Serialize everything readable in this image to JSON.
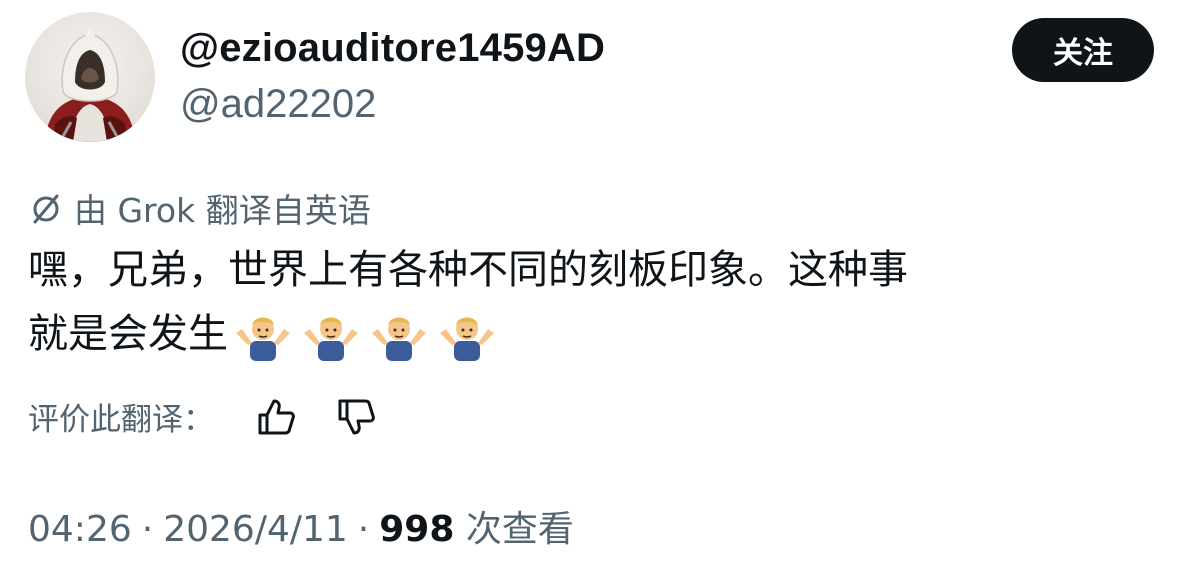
{
  "author": {
    "display_name": "@ezioauditore1459AD",
    "handle": "@ad22202",
    "avatar_icon": "hooded-assassin-avatar"
  },
  "follow_button": {
    "label": "关注"
  },
  "translation_note": {
    "icon": "translate-slash-icon",
    "text": "由 Grok 翻译自英语"
  },
  "tweet": {
    "line1": "嘿，兄弟，世界上有各种不同的刻板印象。这种事",
    "line2": "就是会发生",
    "emojis": [
      "man-shrugging-emoji",
      "man-shrugging-emoji",
      "man-shrugging-emoji",
      "man-shrugging-emoji"
    ]
  },
  "rate_translation": {
    "label": "评价此翻译：",
    "thumbs_up_icon": "thumbs-up-icon",
    "thumbs_down_icon": "thumbs-down-icon"
  },
  "meta": {
    "time": "04:26",
    "separator": "·",
    "date": "2026/4/11",
    "views": "998",
    "views_label": "次查看"
  }
}
